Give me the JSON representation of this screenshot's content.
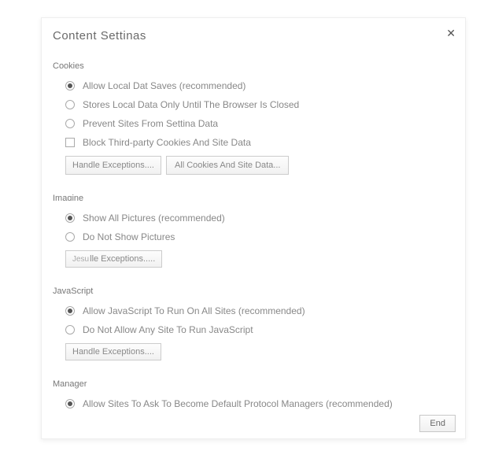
{
  "dialog": {
    "title": "Content Settinas"
  },
  "sections": {
    "cookies": {
      "label": "Cookies",
      "opt1": "Allow Local Dat Saves (recommended)",
      "opt2": "Stores Local Data Only Until The Browser Is Closed",
      "opt3": "Prevent Sites From Settina Data",
      "opt4": "Block Third-party Cookies And Site Data",
      "btn1": "Handle Exceptions....",
      "btn2": "All Cookies And Site Data..."
    },
    "images": {
      "label": "Imaɑine",
      "opt1": "Show All Pictures (recommended)",
      "opt2": "Do Not Show Pictures",
      "btn1_prefix": "Jesu",
      "btn1_suffix": "lle Exceptions....."
    },
    "javascript": {
      "label": "JavaScript",
      "opt1": "Allow JavaScript To Run On All Sites (recommended)",
      "opt2": "Do Not Allow Any Site To Run JavaScript",
      "btn1": "Handle Exceptions...."
    },
    "manager": {
      "label": "Manager",
      "opt1": "Allow Sites To Ask To Become Default Protocol Managers (recommended)"
    }
  },
  "footer": {
    "end": "End"
  }
}
